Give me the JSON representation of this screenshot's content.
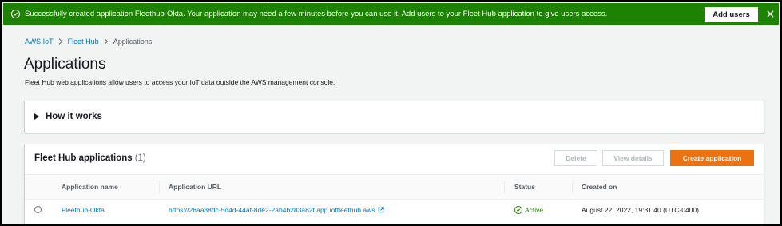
{
  "flash": {
    "message": "Successfully created application Fleethub-Okta. Your application may need a few minutes before you can use it. Add users to your Fleet Hub application to give users access.",
    "action_label": "Add users",
    "color": "#1d8102",
    "icon": "success-check-icon",
    "close_icon": "close-icon"
  },
  "breadcrumb": {
    "items": [
      "AWS IoT",
      "Fleet Hub",
      "Applications"
    ]
  },
  "page": {
    "title": "Applications",
    "description": "Fleet Hub web applications allow users to access your IoT data outside the AWS management console."
  },
  "how_it_works": {
    "label": "How it works"
  },
  "table": {
    "title": "Fleet Hub applications",
    "count": "(1)",
    "buttons": {
      "delete": "Delete",
      "view_details": "View details",
      "create": "Create application"
    },
    "columns": [
      "Application name",
      "Application URL",
      "Status",
      "Created on"
    ],
    "rows": [
      {
        "name": "Fleethub-Okta",
        "url": "https://26aa38dc-5d4d-44af-8de2-2ab4b283a82f.app.iotfleethub.aws",
        "status": "Active",
        "created_on": "August 22, 2022, 19:31:40 (UTC-0400)"
      }
    ]
  },
  "colors": {
    "link": "#0073bb",
    "primary_button": "#ec7211",
    "success": "#1d8102"
  }
}
